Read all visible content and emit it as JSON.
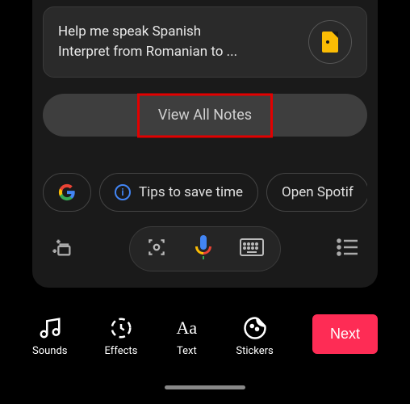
{
  "card": {
    "line1": "Help me speak Spanish",
    "line2": "Interpret from Romanian to ..."
  },
  "view_all_notes": "View All Notes",
  "chips": {
    "tips": "Tips to save time",
    "spotify": "Open Spotif"
  },
  "tools": {
    "sounds": "Sounds",
    "effects": "Effects",
    "text": "Text",
    "stickers": "Stickers"
  },
  "next_label": "Next"
}
